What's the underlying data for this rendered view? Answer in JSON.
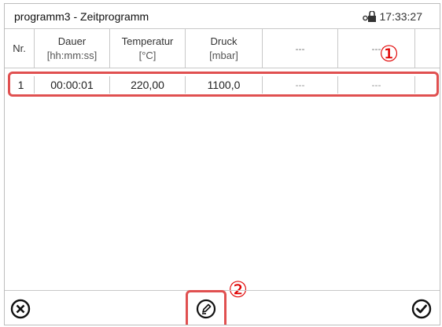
{
  "window": {
    "title": "programm3 - Zeitprogramm",
    "time": "17:33:27"
  },
  "table": {
    "columns": [
      {
        "name": "Nr.",
        "unit": ""
      },
      {
        "name": "Dauer",
        "unit": "[hh:mm:ss]"
      },
      {
        "name": "Temperatur",
        "unit": "[°C]"
      },
      {
        "name": "Druck",
        "unit": "[mbar]"
      },
      {
        "name": "---",
        "unit": ""
      },
      {
        "name": "---",
        "unit": ""
      }
    ],
    "rows": [
      {
        "nr": "1",
        "dauer": "00:00:01",
        "temperatur": "220,00",
        "druck": "1100,0",
        "c5": "---",
        "c6": "---"
      }
    ]
  },
  "callouts": {
    "one": "①",
    "two": "②"
  },
  "colors": {
    "highlight": "#e05050",
    "callout": "#e00000"
  },
  "icons": {
    "lock": "lock-icon",
    "cancel": "cancel-circle-icon",
    "edit": "edit-pencil-icon",
    "confirm": "checkmark-circle-icon"
  }
}
